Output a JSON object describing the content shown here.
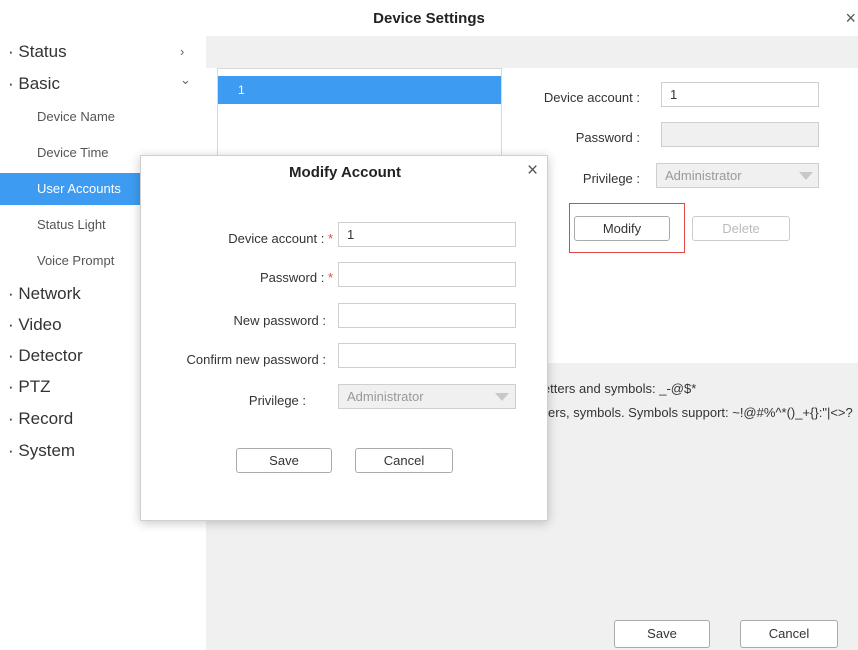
{
  "window": {
    "title": "Device Settings",
    "close_glyph": "×"
  },
  "sidebar": {
    "items": [
      {
        "label": "· Status",
        "chevron": "›"
      },
      {
        "label": "· Basic",
        "chevron": "⌄"
      },
      {
        "label": "· Network"
      },
      {
        "label": "· Video"
      },
      {
        "label": "· Detector"
      },
      {
        "label": "· PTZ"
      },
      {
        "label": "· Record"
      },
      {
        "label": "· System"
      }
    ],
    "basic_subitems": [
      {
        "label": "Device Name"
      },
      {
        "label": "Device Time"
      },
      {
        "label": "User Accounts"
      },
      {
        "label": "Status Light"
      },
      {
        "label": "Voice Prompt"
      }
    ]
  },
  "account_list": {
    "rows": [
      "1"
    ]
  },
  "account_form": {
    "device_account_label": "Device account :",
    "device_account_value": "1",
    "password_label": "Password :",
    "privilege_label": "Privilege :",
    "privilege_value": "Administrator",
    "modify_label": "Modify",
    "delete_label": "Delete"
  },
  "hints": {
    "line1": "letters and symbols: _-@$*",
    "line2": "ers, symbols. Symbols support: ~!@#%^*()_+{}:\"|<>?"
  },
  "footer": {
    "save_label": "Save",
    "cancel_label": "Cancel"
  },
  "modal": {
    "title": "Modify Account",
    "close_glyph": "×",
    "device_account_label": "Device account :",
    "device_account_value": "1",
    "password_label": "Password :",
    "new_password_label": "New password :",
    "confirm_password_label": "Confirm new password :",
    "privilege_label": "Privilege :",
    "privilege_value": "Administrator",
    "required_mark": "*",
    "save_label": "Save",
    "cancel_label": "Cancel"
  },
  "colors": {
    "accent": "#3d9cf1",
    "required": "#e04848",
    "highlight_outline": "#e04848"
  }
}
